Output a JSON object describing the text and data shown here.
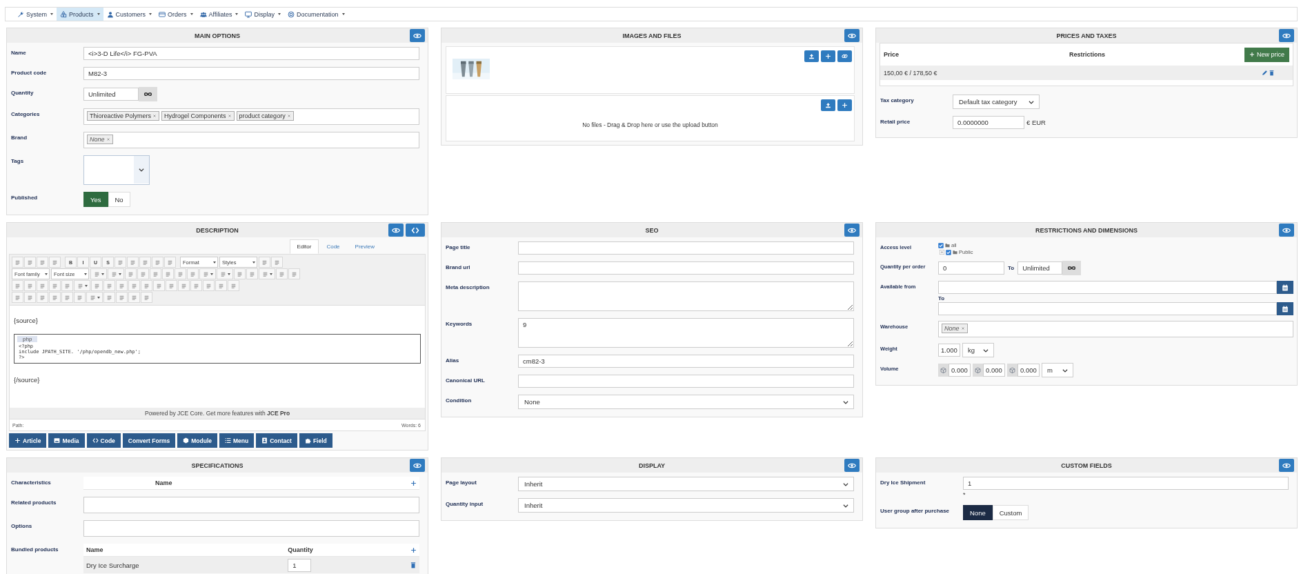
{
  "menu": [
    {
      "label": "System",
      "selected": false
    },
    {
      "label": "Products",
      "selected": true
    },
    {
      "label": "Customers",
      "selected": false
    },
    {
      "label": "Orders",
      "selected": false
    },
    {
      "label": "Affiliates",
      "selected": false
    },
    {
      "label": "Display",
      "selected": false
    },
    {
      "label": "Documentation",
      "selected": false
    }
  ],
  "panels": [
    {
      "title": "MAIN OPTIONS",
      "kind": "form",
      "fields": [
        {
          "kind": "text",
          "label": "Name",
          "value": "<i>3-D Life</i> FG-PVA"
        },
        {
          "kind": "text",
          "label": "Product code",
          "value": "M82-3"
        },
        {
          "kind": "unlimited",
          "label": "Quantity",
          "value": "Unlimited"
        },
        {
          "kind": "tags",
          "label": "Categories",
          "tags": [
            {
              "label": "Thioreactive Polymers",
              "kind": "value"
            },
            {
              "label": "Hydrogel Components",
              "kind": "value"
            },
            {
              "label": "product category",
              "kind": "value"
            }
          ]
        },
        {
          "kind": "tags",
          "label": "Brand",
          "tags": [
            {
              "label": "None",
              "kind": "placeholder"
            }
          ]
        },
        {
          "kind": "multiselect",
          "label": "Tags"
        },
        {
          "kind": "yesno",
          "label": "Published",
          "options": [
            {
              "label": "Yes",
              "selected": true
            },
            {
              "label": "No",
              "selected": false
            }
          ]
        }
      ]
    },
    {
      "title": "IMAGES AND FILES",
      "kind": "images",
      "files_message": "No files - Drag & Drop here or use the upload button"
    },
    {
      "title": "PRICES AND TAXES",
      "kind": "prices",
      "price_columns": [
        "Price",
        "Restrictions"
      ],
      "new_price": "New price",
      "prices": [
        {
          "price": "150,00 € / 178,50 €"
        }
      ],
      "fields": [
        {
          "kind": "compact_select",
          "label": "Tax category",
          "value": "Default tax category"
        },
        {
          "kind": "price",
          "label": "Retail price",
          "value": "0.0000000",
          "suffix": "€ EUR"
        }
      ]
    },
    {
      "title": "DESCRIPTION",
      "kind": "editor",
      "tabs": [
        {
          "label": "Editor",
          "selected": true
        },
        {
          "label": "Code",
          "selected": false
        },
        {
          "label": "Preview",
          "selected": false
        }
      ],
      "toolbar": [
        [
          {
            "kind": "icon"
          },
          {
            "kind": "icon"
          },
          {
            "kind": "icon"
          },
          {
            "kind": "icon"
          },
          {
            "kind": "separator"
          },
          {
            "kind": "text",
            "label": "B"
          },
          {
            "kind": "text",
            "label": "I"
          },
          {
            "kind": "text",
            "label": "U"
          },
          {
            "kind": "text",
            "label": "S"
          },
          {
            "kind": "icon"
          },
          {
            "kind": "icon"
          },
          {
            "kind": "icon"
          },
          {
            "kind": "icon"
          },
          {
            "kind": "icon"
          },
          {
            "kind": "separator"
          },
          {
            "kind": "dropdown",
            "label": "Format"
          },
          {
            "kind": "dropdown",
            "label": "Styles"
          },
          {
            "kind": "icon"
          },
          {
            "kind": "icon"
          }
        ],
        [
          {
            "kind": "dropdown",
            "label": "Font family"
          },
          {
            "kind": "dropdown",
            "label": "Font size"
          },
          {
            "kind": "split"
          },
          {
            "kind": "split"
          },
          {
            "kind": "icon"
          },
          {
            "kind": "icon"
          },
          {
            "kind": "icon"
          },
          {
            "kind": "icon"
          },
          {
            "kind": "icon"
          },
          {
            "kind": "icon"
          },
          {
            "kind": "split"
          },
          {
            "kind": "split"
          },
          {
            "kind": "icon"
          },
          {
            "kind": "icon"
          },
          {
            "kind": "split"
          },
          {
            "kind": "icon"
          },
          {
            "kind": "icon"
          }
        ],
        [
          {
            "kind": "icon"
          },
          {
            "kind": "icon"
          },
          {
            "kind": "icon"
          },
          {
            "kind": "icon"
          },
          {
            "kind": "icon"
          },
          {
            "kind": "split"
          },
          {
            "kind": "icon"
          },
          {
            "kind": "icon"
          },
          {
            "kind": "icon"
          },
          {
            "kind": "icon"
          },
          {
            "kind": "icon"
          },
          {
            "kind": "icon"
          },
          {
            "kind": "icon"
          },
          {
            "kind": "icon"
          },
          {
            "kind": "icon"
          },
          {
            "kind": "icon"
          },
          {
            "kind": "icon"
          },
          {
            "kind": "icon"
          }
        ],
        [
          {
            "kind": "icon"
          },
          {
            "kind": "icon"
          },
          {
            "kind": "icon"
          },
          {
            "kind": "icon"
          },
          {
            "kind": "icon"
          },
          {
            "kind": "icon"
          },
          {
            "kind": "split"
          },
          {
            "kind": "icon"
          },
          {
            "kind": "icon"
          },
          {
            "kind": "icon"
          },
          {
            "kind": "icon"
          }
        ]
      ],
      "content": {
        "before": "{source}",
        "language": "php",
        "code": [
          "<?php",
          "include JPATH_SITE. '/php/opendb_new.php';",
          "?>"
        ],
        "after": "{/source}"
      },
      "footer": "Powered by JCE Core. Get more features with **JCE Pro**",
      "path": "Path:",
      "words": "Words: 6",
      "insert_buttons": [
        "Article",
        "Media",
        "Code",
        "Convert Forms",
        "Module",
        "Menu",
        "Contact",
        "Field"
      ]
    },
    {
      "title": "SEO",
      "kind": "form",
      "fields": [
        {
          "kind": "text",
          "label": "Page title"
        },
        {
          "kind": "text",
          "label": "Brand url"
        },
        {
          "kind": "textarea",
          "label": "Meta description"
        },
        {
          "kind": "textarea",
          "label": "Keywords",
          "value": "9"
        },
        {
          "kind": "text",
          "label": "Alias",
          "value": "cm82-3"
        },
        {
          "kind": "text",
          "label": "Canonical URL"
        },
        {
          "kind": "select",
          "label": "Condition",
          "value": "None"
        }
      ]
    },
    {
      "title": "RESTRICTIONS AND DIMENSIONS",
      "kind": "form",
      "fields": [
        {
          "kind": "access",
          "label": "Access level",
          "tree": [
            {
              "label": "all",
              "checked": true,
              "children": [
                {
                  "label": "Public",
                  "checked": true,
                  "expanded": false
                }
              ]
            }
          ]
        },
        {
          "kind": "range",
          "label": "Quantity per order",
          "from": "0",
          "to_label": "To",
          "to": "Unlimited"
        },
        {
          "kind": "dates",
          "label": "Available from",
          "to_label": "To"
        },
        {
          "kind": "tags",
          "label": "Warehouse",
          "tags": [
            {
              "label": "None",
              "kind": "placeholder"
            }
          ]
        },
        {
          "kind": "weight",
          "label": "Weight",
          "values": [
            "1.000"
          ],
          "unit": "kg"
        },
        {
          "kind": "volume",
          "label": "Volume",
          "values": [
            "0.000",
            "0.000",
            "0.000"
          ],
          "unit": "m"
        }
      ]
    },
    {
      "title": "SPECIFICATIONS",
      "kind": "form",
      "fields": [
        {
          "kind": "list_header",
          "label": "Characteristics",
          "columns": [
            "Name"
          ]
        },
        {
          "kind": "tags",
          "label": "Related products"
        },
        {
          "kind": "tags",
          "label": "Options"
        },
        {
          "kind": "bundle",
          "label": "Bundled products",
          "columns": [
            "Name",
            "Quantity"
          ],
          "rows": [
            {
              "name": "Dry Ice Surcharge",
              "quantity": "1"
            }
          ]
        }
      ]
    },
    {
      "title": "DISPLAY",
      "kind": "form",
      "fields": [
        {
          "kind": "select",
          "label": "Page layout",
          "value": "Inherit"
        },
        {
          "kind": "select",
          "label": "Quantity input",
          "value": "Inherit"
        }
      ]
    },
    {
      "title": "CUSTOM FIELDS",
      "kind": "form",
      "fields": [
        {
          "kind": "text",
          "label": "Dry Ice Shipment",
          "value": "1",
          "note": "*"
        },
        {
          "kind": "radio",
          "label": "User group after purchase",
          "options": [
            {
              "label": "None",
              "selected": true
            },
            {
              "label": "Custom",
              "selected": false
            }
          ]
        }
      ]
    }
  ]
}
